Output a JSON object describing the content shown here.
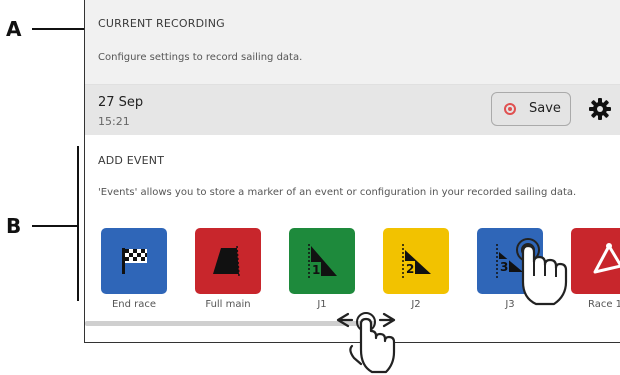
{
  "callouts": {
    "a": "A",
    "b": "B"
  },
  "recording": {
    "title": "CURRENT RECORDING",
    "description": "Configure settings to record sailing data.",
    "date": "27 Sep",
    "time": "15:21",
    "save_label": "Save"
  },
  "events": {
    "title": "ADD EVENT",
    "description": "'Events' allows you to store a marker of an event or configuration in your recorded sailing data.",
    "items": [
      {
        "label": "End race",
        "icon": "checkered-flag-icon",
        "color": "#2f66b8"
      },
      {
        "label": "Full main",
        "icon": "mainsail-icon",
        "color": "#c8262c"
      },
      {
        "label": "J1",
        "icon": "jib-1-icon",
        "color": "#1e8a3c"
      },
      {
        "label": "J2",
        "icon": "jib-2-icon",
        "color": "#f2c200"
      },
      {
        "label": "J3",
        "icon": "jib-3-icon",
        "color": "#2f66b8"
      },
      {
        "label": "Race 1",
        "icon": "race-course-icon",
        "color": "#c8262c"
      }
    ]
  },
  "colors": {
    "record": "#e05050",
    "scroll_track": "#cfcfcf"
  }
}
